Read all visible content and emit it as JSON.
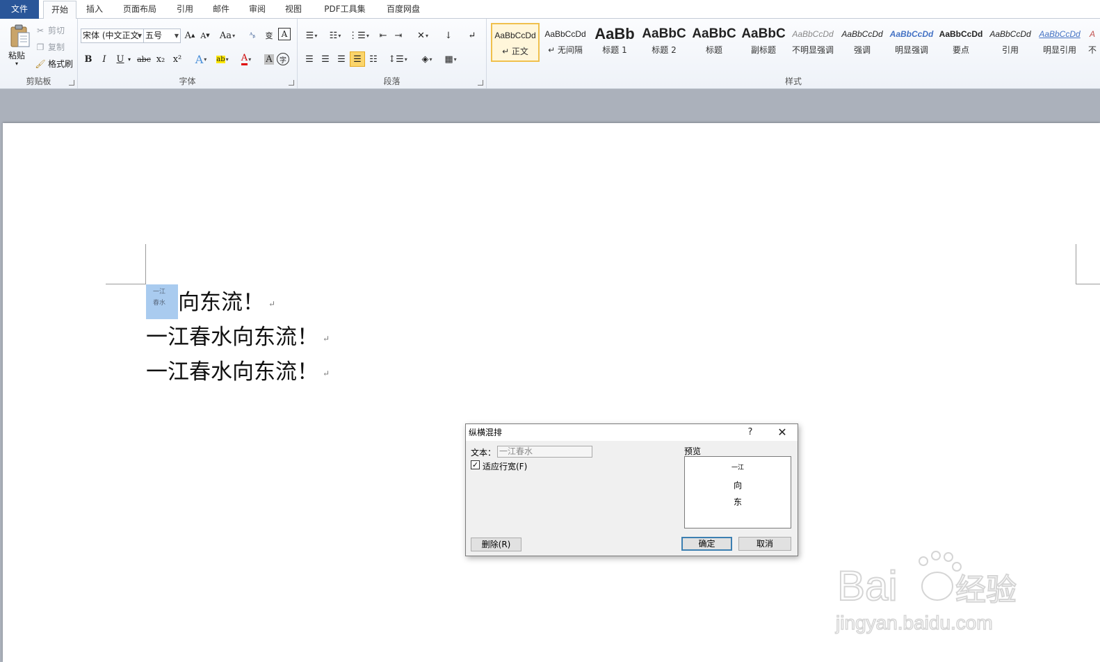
{
  "tabs": [
    {
      "label": "文件",
      "kind": "file"
    },
    {
      "label": "开始",
      "kind": "active"
    },
    {
      "label": "插入"
    },
    {
      "label": "页面布局"
    },
    {
      "label": "引用"
    },
    {
      "label": "邮件"
    },
    {
      "label": "审阅"
    },
    {
      "label": "视图"
    },
    {
      "label": "PDF工具集"
    },
    {
      "label": "百度网盘"
    }
  ],
  "clipboard": {
    "paste_label": "粘贴",
    "cut_label": "剪切",
    "copy_label": "复制",
    "format_painter_label": "格式刷",
    "group_label": "剪贴板"
  },
  "font": {
    "font_name": "宋体 (中文正文",
    "font_size": "五号",
    "group_label": "字体",
    "case_label": "Aa",
    "icons": [
      "bold-icon",
      "italic-icon",
      "underline-icon",
      "strikethrough-icon",
      "subscript-icon",
      "superscript-icon",
      "text-effects-icon",
      "highlight-icon",
      "font-color-icon",
      "character-shading-icon",
      "enclose-characters-icon"
    ],
    "glyphs": {
      "grow": "A",
      "shrink": "A",
      "bold": "B",
      "italic": "I",
      "underline": "U",
      "strike": "abc",
      "sub": "x₂",
      "sup": "x²",
      "effects": "A",
      "highlight": "ab",
      "color": "A",
      "shading": "A",
      "enclose": "字",
      "phonetic": "wén",
      "clear": "变",
      "border": "A"
    }
  },
  "paragraph": {
    "group_label": "段落"
  },
  "styles": {
    "group_label": "样式",
    "items": [
      {
        "sample": "AaBbCcDd",
        "name": "↵ 正文",
        "selected": true
      },
      {
        "sample": "AaBbCcDd",
        "name": "↵ 无间隔"
      },
      {
        "sample": "AaBb",
        "name": "标题 1"
      },
      {
        "sample": "AaBbC",
        "name": "标题 2"
      },
      {
        "sample": "AaBbC",
        "name": "标题"
      },
      {
        "sample": "AaBbC",
        "name": "副标题"
      },
      {
        "sample": "AaBbCcDd",
        "name": "不明显强调"
      },
      {
        "sample": "AaBbCcDd",
        "name": "强调"
      },
      {
        "sample": "AaBbCcDd",
        "name": "明显强调"
      },
      {
        "sample": "AaBbCcDd",
        "name": "要点"
      },
      {
        "sample": "AaBbCcDd",
        "name": "引用"
      },
      {
        "sample": "AaBbCcDd",
        "name": "明显引用"
      },
      {
        "sample": "A",
        "name": "不"
      }
    ]
  },
  "document": {
    "combined_chars": [
      "一江",
      "春水"
    ],
    "lines": [
      {
        "text": "向东流！"
      },
      {
        "text": "一江春水向东流！"
      },
      {
        "text": "一江春水向东流！"
      }
    ],
    "para_mark": "↵"
  },
  "dialog": {
    "title": "纵横混排",
    "help": "?",
    "text_label": "文本：",
    "text_value": "一江春水",
    "fit_label": "适应行宽(F)",
    "fit_checked": true,
    "preview_label": "预览",
    "preview_chars": [
      "一江",
      "向",
      "东"
    ],
    "delete_label": "删除(R)",
    "ok_label": "确定",
    "cancel_label": "取消"
  },
  "watermark": {
    "brand": "Baidu经验",
    "url": "jingyan.baidu.com"
  }
}
